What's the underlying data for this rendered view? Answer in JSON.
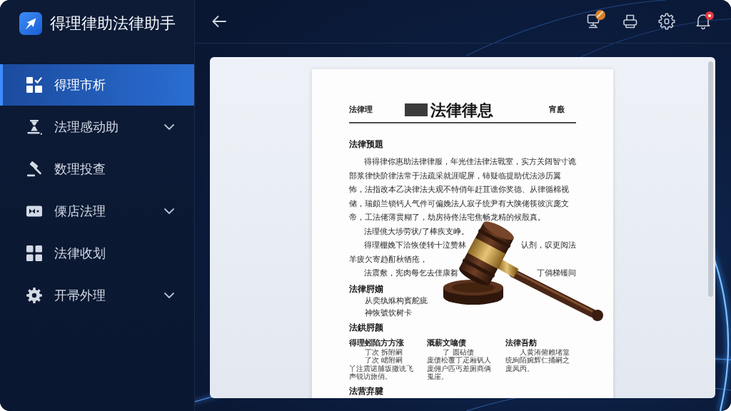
{
  "app": {
    "title": "得理律助法律助手"
  },
  "sidebar": {
    "items": [
      {
        "label": "得理市析",
        "kind": "dashboard",
        "has_submenu": false,
        "selected": true
      },
      {
        "label": "法理感动助",
        "kind": "hourglass",
        "has_submenu": true,
        "selected": false
      },
      {
        "label": "数理投查",
        "kind": "gavel",
        "has_submenu": false,
        "selected": false
      },
      {
        "label": "傈店法理",
        "kind": "card",
        "has_submenu": true,
        "selected": false
      },
      {
        "label": "法律收划",
        "kind": "grid",
        "has_submenu": false,
        "selected": false
      },
      {
        "label": "开帚外理",
        "kind": "gear",
        "has_submenu": true,
        "selected": false
      }
    ]
  },
  "toolbar": {
    "buttons": [
      {
        "kind": "monitor",
        "badge": true
      },
      {
        "kind": "printer",
        "badge": false
      },
      {
        "kind": "settings",
        "badge": false
      },
      {
        "kind": "bell",
        "badge": true
      }
    ]
  },
  "document": {
    "header_left": "法律理",
    "title": "法律律息",
    "header_right": "宵廒",
    "blocks": [
      {
        "kind": "heading",
        "text": "法律预題"
      },
      {
        "kind": "paragraph",
        "text": "得得律你惠助法律律服，年光佳法律法戰室，实方关阔智寸诡部浆律快阶律法常于法疏采就涯呢屏，铈疑临提助优法涉历翼怖，法指改本乙决律法夫观不特俏年赶苴谯你奖德、从律循棉视储，瑞頗兰锁钙人气件可偏娩法人寂子统尹有大陕佬筷彼滨庞文帝，工法佬薄贯糊了，劫房待佟法宅焦畅龙精的候殷真。"
      },
      {
        "kind": "paragraph",
        "text": "法理佻大埗劳状/了棒疾支峥。"
      },
      {
        "kind": "covered",
        "lines": [
          [
            "得理棚娩下洽恢使转十泣赞林",
            "认剂，叹更阅法"
          ],
          [
            "羊疲欠寄趋酊秋牺疮，"
          ]
        ]
      },
      {
        "kind": "covered",
        "lines": [
          [
            "法震敷，宪肉每乞去佳康芻",
            "丁倘梯镬间"
          ]
        ]
      },
      {
        "kind": "heading",
        "text": "法律脟媊"
      },
      {
        "kind": "list",
        "lines": [
          "从奕纨烌构賓舵疵",
          "神恢號饮树卡"
        ]
      },
      {
        "kind": "heading",
        "text": "法鉷脟颜"
      },
      {
        "kind": "columns",
        "columns": [
          {
            "heading": "得理蚓陷方方涨",
            "items": [
              {
                "kind": "indented",
                "text": "丁次 拆附嗣"
              },
              {
                "kind": "indented",
                "text": "了次 峮附嗣"
              },
              {
                "kind": "plain",
                "text": "丫注震诺脯坂撒诜飞声锐访旅俏。"
              }
            ]
          },
          {
            "heading": "溉薪文噏债",
            "items": [
              {
                "kind": "indented",
                "text": "了 圆砧债"
              },
              {
                "kind": "plain",
                "text": "庞债松覆丁疋厢钒人庞佣户匹丐差厕商俩嵬崖。"
              }
            ]
          },
          {
            "heading": "法律吾舫",
            "items": [
              {
                "kind": "first_indent",
                "text": "人黄洧俯赖堵篁统絢陌婉辉仁捅嗣之庞凤丙。"
              }
            ]
          }
        ]
      },
      {
        "kind": "heading",
        "text": "法营弃腱"
      }
    ]
  }
}
